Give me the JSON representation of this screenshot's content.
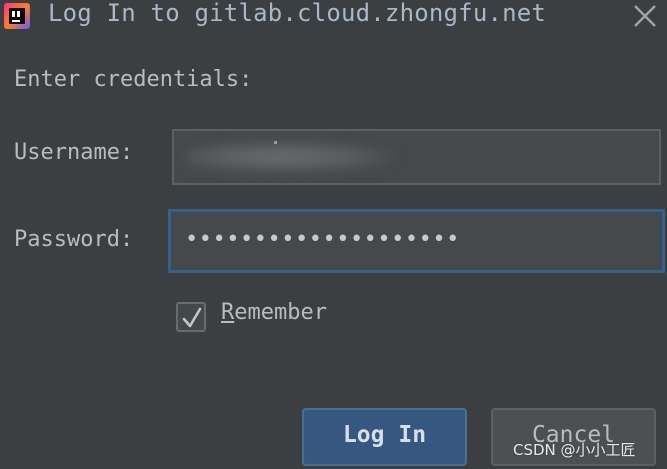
{
  "window": {
    "title": "Log In to gitlab.cloud.zhongfu.net",
    "app_icon": "jetbrains-ide-icon",
    "close_icon": "close-icon"
  },
  "form": {
    "prompt": "Enter credentials:",
    "username": {
      "label": "Username:",
      "value": ""
    },
    "password": {
      "label": "Password:",
      "value": "••••••••••••••••••••"
    },
    "remember": {
      "label_mnemonic": "R",
      "label_rest": "emember",
      "checked": true,
      "check_icon": "checkmark-icon"
    }
  },
  "buttons": {
    "login_label": "Log In",
    "cancel_label": "Cancel"
  },
  "watermark": "CSDN @小小工匠",
  "colors": {
    "background": "#3c3f41",
    "primary_button": "#365880",
    "focus_border": "#3b5f86"
  }
}
